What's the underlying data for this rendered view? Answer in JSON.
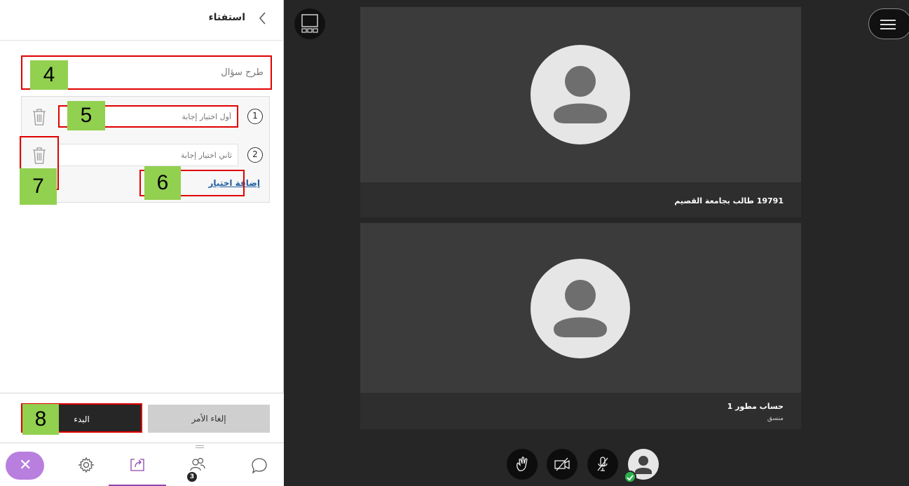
{
  "panel": {
    "title": "استفتاء",
    "question_placeholder": "طرح سؤال",
    "choices": [
      {
        "number": "1",
        "placeholder": "أول اختيار إجابة"
      },
      {
        "number": "2",
        "placeholder": "ثاني اختيار إجابة"
      }
    ],
    "add_choice": "إضافة اختيار",
    "start_label": "البدء",
    "cancel_label": "إلغاء الأمر"
  },
  "annotations": {
    "n4": "4",
    "n5": "5",
    "n6": "6",
    "n7": "7",
    "n8": "8",
    "highlight_color": "#e00000",
    "badge_color": "#92d050"
  },
  "tabs": [
    {
      "name": "close",
      "icon": "close-icon"
    },
    {
      "name": "settings",
      "icon": "gear-icon"
    },
    {
      "name": "share",
      "icon": "share-icon"
    },
    {
      "name": "participants",
      "icon": "participants-icon",
      "badge": "3"
    },
    {
      "name": "chat",
      "icon": "chat-icon"
    }
  ],
  "participants": [
    {
      "name": "19791 طالب بجامعة القصيم",
      "role": ""
    },
    {
      "name": "حساب مطور 1",
      "role": "منسق"
    }
  ],
  "controls": [
    "hand-raise-icon",
    "camera-off-icon",
    "mic-off-icon",
    "my-status-avatar"
  ],
  "colors": {
    "accent": "#8e44ad",
    "close_tab": "#b87fdf",
    "link": "#1f5f9f",
    "status_ok": "#2bb24c"
  }
}
